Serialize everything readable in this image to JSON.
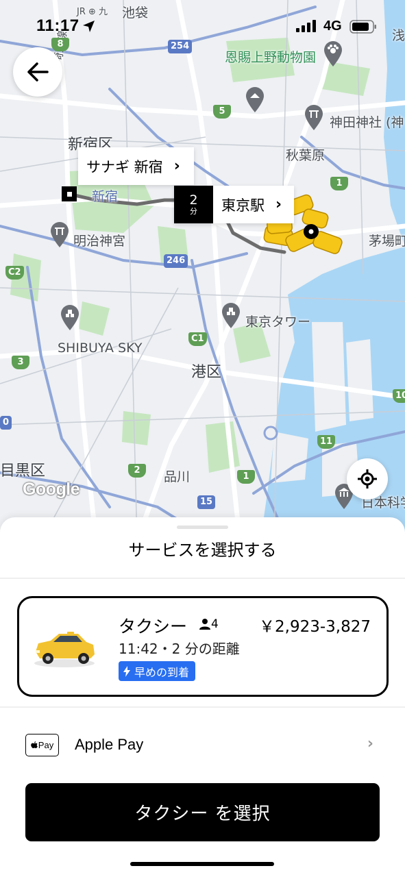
{
  "status_bar": {
    "time": "11:17",
    "network": "4G"
  },
  "map": {
    "labels": {
      "ikebukuro": "池袋",
      "ikebukuro_lines": "JR ⊕ 九",
      "saikyo_line": "埼京線",
      "ueno_zoo": "恩賜上野動物園",
      "shinjuku_ward": "新宿区",
      "kanda_shrine": "神田神社 (神",
      "akihabara": "秋葉原",
      "shinjuku_station": "新宿",
      "meiji_jingu": "明治神宮",
      "kayabacho": "茅場町",
      "tokyo_tower": "東京タワー",
      "shibuya_sky": "SHIBUYA SKY",
      "minato_ward": "港区",
      "meguro_ward": "目黒区",
      "shinagawa": "品川",
      "nihon_kagaku": "日本科学",
      "asakusa": "浅"
    },
    "route_shields": [
      "8",
      "254",
      "5",
      "1",
      "C2",
      "246",
      "C1",
      "3",
      "2",
      "1",
      "15",
      "11",
      "10",
      "0"
    ],
    "google_logo": "Google",
    "pickup_callout": {
      "label": "サナギ 新宿",
      "chevron": "›"
    },
    "dest_callout": {
      "eta_number": "2",
      "eta_unit": "分",
      "label": "東京駅",
      "chevron": "›"
    }
  },
  "sheet": {
    "title": "サービスを選択する",
    "option": {
      "name": "タクシー",
      "capacity": "4",
      "price": "￥2,923-3,827",
      "eta": "11:42・2 分の距離",
      "badge": "早めの到着"
    },
    "payment": {
      "icon_text": "Pay",
      "label": "Apple Pay",
      "chevron": "›"
    },
    "select_button": "タクシー を選択"
  },
  "colors": {
    "accent_blue": "#276ef1",
    "taxi_yellow": "#f5c518",
    "map_water": "#aadaff",
    "map_park": "#c8e6c4"
  }
}
